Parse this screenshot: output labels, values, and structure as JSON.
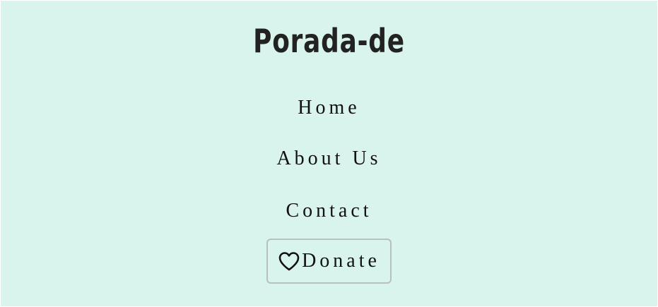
{
  "header": {
    "brand": "Porada-de"
  },
  "nav": {
    "items": [
      {
        "label": "Home"
      },
      {
        "label": "About Us"
      },
      {
        "label": "Contact"
      }
    ],
    "donate": {
      "label": "Donate",
      "icon": "heart-icon"
    }
  },
  "colors": {
    "background": "#d8f4ec",
    "text": "#111111",
    "button_border": "#b8c0bd"
  }
}
